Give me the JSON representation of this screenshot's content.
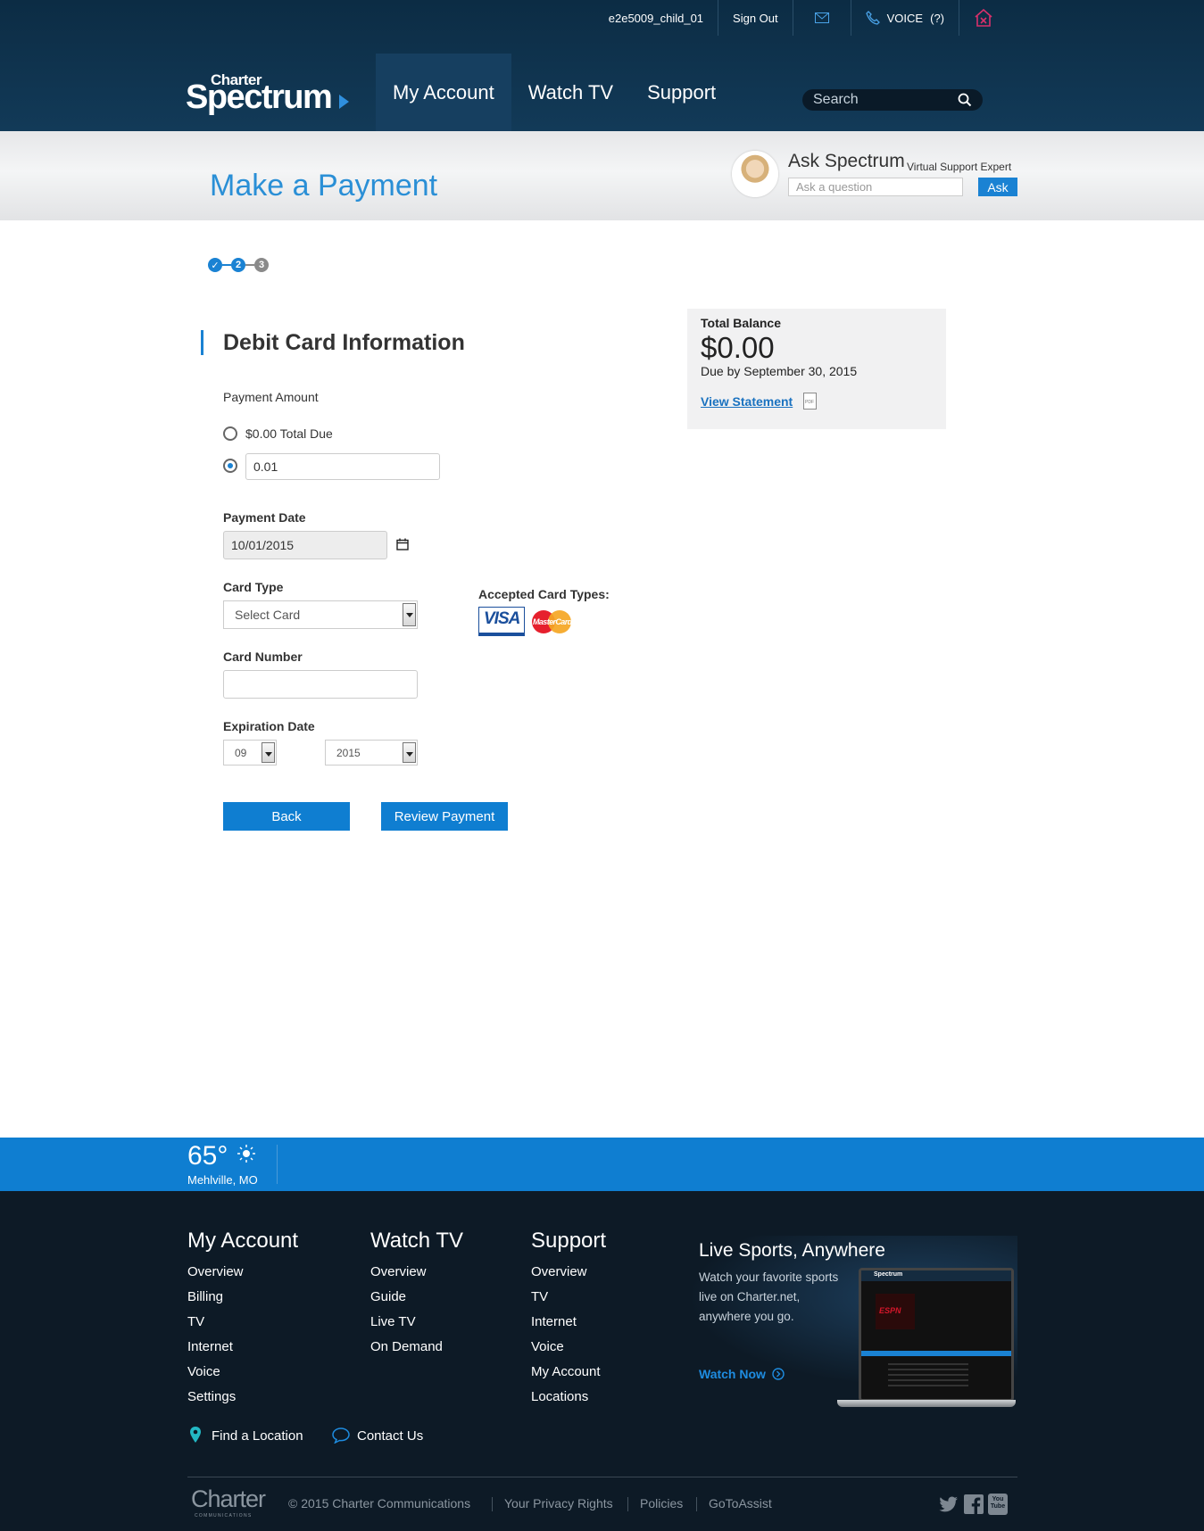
{
  "utility": {
    "username": "e2e5009_child_01",
    "sign_out": "Sign Out",
    "voice": "VOICE",
    "voice_count": "(?)"
  },
  "logo": {
    "small": "Charter",
    "big": "Spectrum"
  },
  "nav": {
    "items": [
      "My Account",
      "Watch TV",
      "Support"
    ],
    "active": "My Account"
  },
  "search": {
    "placeholder": "Search"
  },
  "banner": {
    "title": "Make a Payment",
    "ask_title": "Ask Spectrum",
    "ask_subtitle": "Virtual Support Expert",
    "ask_placeholder": "Ask a question",
    "ask_button": "Ask"
  },
  "steps": [
    "✓",
    "2",
    "3"
  ],
  "form": {
    "section_title": "Debit Card Information",
    "payment_amount_label": "Payment Amount",
    "option_total_due": "$0.00 Total Due",
    "custom_amount": "0.01",
    "payment_date_label": "Payment Date",
    "payment_date": "10/01/2015",
    "card_type_label": "Card Type",
    "card_type_value": "Select Card",
    "accepted_label": "Accepted Card Types:",
    "visa": "VISA",
    "mastercard": "MasterCard",
    "card_number_label": "Card Number",
    "card_number_value": "",
    "expiration_label": "Expiration Date",
    "exp_month": "09",
    "exp_year": "2015",
    "back_button": "Back",
    "review_button": "Review Payment"
  },
  "balance": {
    "label": "Total Balance",
    "amount": "$0.00",
    "due": "Due by September 30, 2015",
    "view_statement": "View Statement",
    "pdf": "PDF"
  },
  "weather": {
    "temp": "65°",
    "location": "Mehlville, MO"
  },
  "footer": {
    "columns": [
      {
        "title": "My Account",
        "links": [
          "Overview",
          "Billing",
          "TV",
          "Internet",
          "Voice",
          "Settings"
        ]
      },
      {
        "title": "Watch TV",
        "links": [
          "Overview",
          "Guide",
          "Live TV",
          "On Demand"
        ]
      },
      {
        "title": "Support",
        "links": [
          "Overview",
          "TV",
          "Internet",
          "Voice",
          "My Account",
          "Locations"
        ]
      }
    ],
    "promo_title": "Live Sports, Anywhere",
    "promo_text_1": "Watch your favorite sports",
    "promo_text_2": "live on Charter.net,",
    "promo_text_3": "anywhere you go.",
    "promo_link": "Watch Now",
    "promo_screen_logo": "Spectrum",
    "promo_screen_channel": "ESPN",
    "find_location": "Find a Location",
    "contact_us": "Contact Us",
    "charter_logo": "Charter",
    "charter_logo_sub": "COMMUNICATIONS",
    "copyright": "© 2015 Charter Communications",
    "legal_links": [
      "Your Privacy Rights",
      "Policies",
      "GoToAssist"
    ],
    "youtube": "You Tube"
  },
  "colors": {
    "brand_blue": "#0f7ed1",
    "header_navy": "#0c2c44",
    "footer_navy": "#0d1a26",
    "title_blue": "#2a8fd6"
  }
}
